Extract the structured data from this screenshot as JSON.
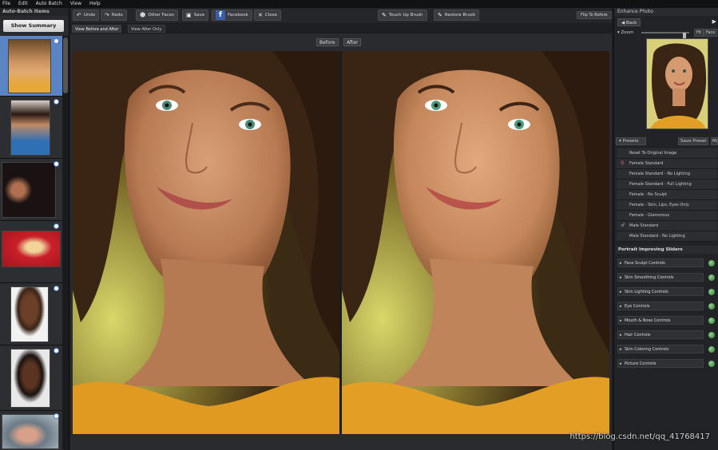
{
  "menu": [
    "File",
    "Edit",
    "Auto Batch",
    "View",
    "Help"
  ],
  "left_panel": {
    "title": "Auto-Batch Items",
    "summary_button": "Show Summary"
  },
  "toolbar": {
    "undo": "Undo",
    "redo": "Redo",
    "other_faces": "Other Faces",
    "save": "Save",
    "facebook": "Facebook",
    "close": "Close",
    "touch_up": "Touch Up Brush",
    "restore": "Restore Brush",
    "flip": "Flip To Before"
  },
  "view_tabs": [
    "View Before and After",
    "View After Only"
  ],
  "viewer": {
    "before_label": "Before",
    "after_label": "After"
  },
  "right_panel": {
    "title": "Enhance Photo",
    "back": "Back",
    "zoom_label": "Zoom",
    "fit": "Fit",
    "face": "Face",
    "presets_label": "Presets",
    "save_preset": "Save Preset",
    "more": "Ma",
    "presets": [
      "Reset To Original Image",
      "Female Standard",
      "Female Standard - No Lighting",
      "Female Standard - Full Lighting",
      "Female - No Sculpt",
      "Female - Skin, Lips, Eyes Only",
      "Female - Glamorous",
      "Male Standard",
      "Male Standard - No Lighting"
    ],
    "sliders_title": "Portrait Improving Sliders",
    "sliders": [
      "Face Sculpt Controls",
      "Skin Smoothing Controls",
      "Skin Lighting Controls",
      "Eye Controls",
      "Mouth & Nose Controls",
      "Hair Controls",
      "Skin Coloring Controls",
      "Picture Controls"
    ]
  },
  "watermark": "https://blog.csdn.net/qq_41768417"
}
